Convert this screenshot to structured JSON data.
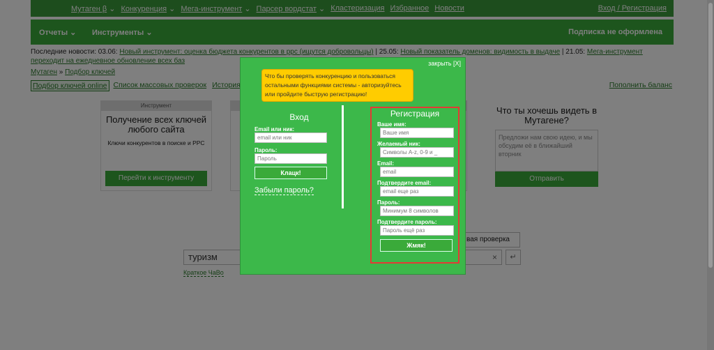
{
  "topnav": {
    "items": [
      "Мутаген β",
      "Конкуренция",
      "Мега-инструмент",
      "Парсер вордстат",
      "Кластеризация",
      "Избранное",
      "Новости"
    ],
    "login": "Вход / Регистрация"
  },
  "menubar": {
    "reports": "Отчеты",
    "tools": "Инструменты",
    "subscription": "Подписка не оформлена"
  },
  "news": {
    "prefix": "Последние новости: 03.06:",
    "item1": "Новый инструмент: оценка бюджета конкурентов в ppc (ищутся добровольцы)",
    "sep1": " | 25.05: ",
    "item2": "Новый показатель доменов: видимость в выдаче",
    "sep2": " | 21.05: ",
    "item3": "Мега-инструмент переходит на ежедневное обновление всех баз"
  },
  "breadcrumbs": {
    "root": "Мутаген",
    "sep": "»",
    "current": "Подбор ключей"
  },
  "tabs": [
    "Подбор ключей online",
    "Список массовых проверок",
    "История про"
  ],
  "balance": "Пополнить баланс",
  "card1": {
    "head": "Инструмент",
    "title": "Получение всех ключей любого сайта",
    "desc": "Ключи конкурентов в поиске и PPC",
    "button": "Перейти к инструменту"
  },
  "card3": {
    "title": "Что ты хочешь видеть в Мутагене?",
    "placeholder": "Предложи нам свою идею, и мы обсудим её в ближайший вторник",
    "button": "Отправить"
  },
  "search": {
    "query": "туризм",
    "faq": "Краткое ЧаВо",
    "mass_check": "вая проверка",
    "clear": "×",
    "go": "↵"
  },
  "modal": {
    "close": "закрыть [X]",
    "notice": "Что бы проверять конкуренцию и пользоваться остальными функциями системы - авторизуйтесь или пройдите быструю регистрацию!",
    "login": {
      "title": "Вход",
      "email_label": "Email или ник:",
      "email_placeholder": "email или ник",
      "password_label": "Пароль:",
      "password_placeholder": "Пароль",
      "submit": "Клацк!",
      "forgot": "Забыли пароль?"
    },
    "register": {
      "title": "Регистрация",
      "name_label": "Ваше имя:",
      "name_placeholder": "Ваше имя",
      "nick_label": "Желаемый ник:",
      "nick_placeholder": "Символы A-z, 0-9 и _",
      "email_label": "Email:",
      "email_placeholder": "email",
      "email2_label": "Подтвердите email:",
      "email2_placeholder": "email еще раз",
      "pass_label": "Пароль:",
      "pass_placeholder": "Минимум 8 символов",
      "pass2_label": "Подтвердите пароль:",
      "pass2_placeholder": "Пароль ещё раз",
      "submit": "Жмяк!"
    }
  }
}
